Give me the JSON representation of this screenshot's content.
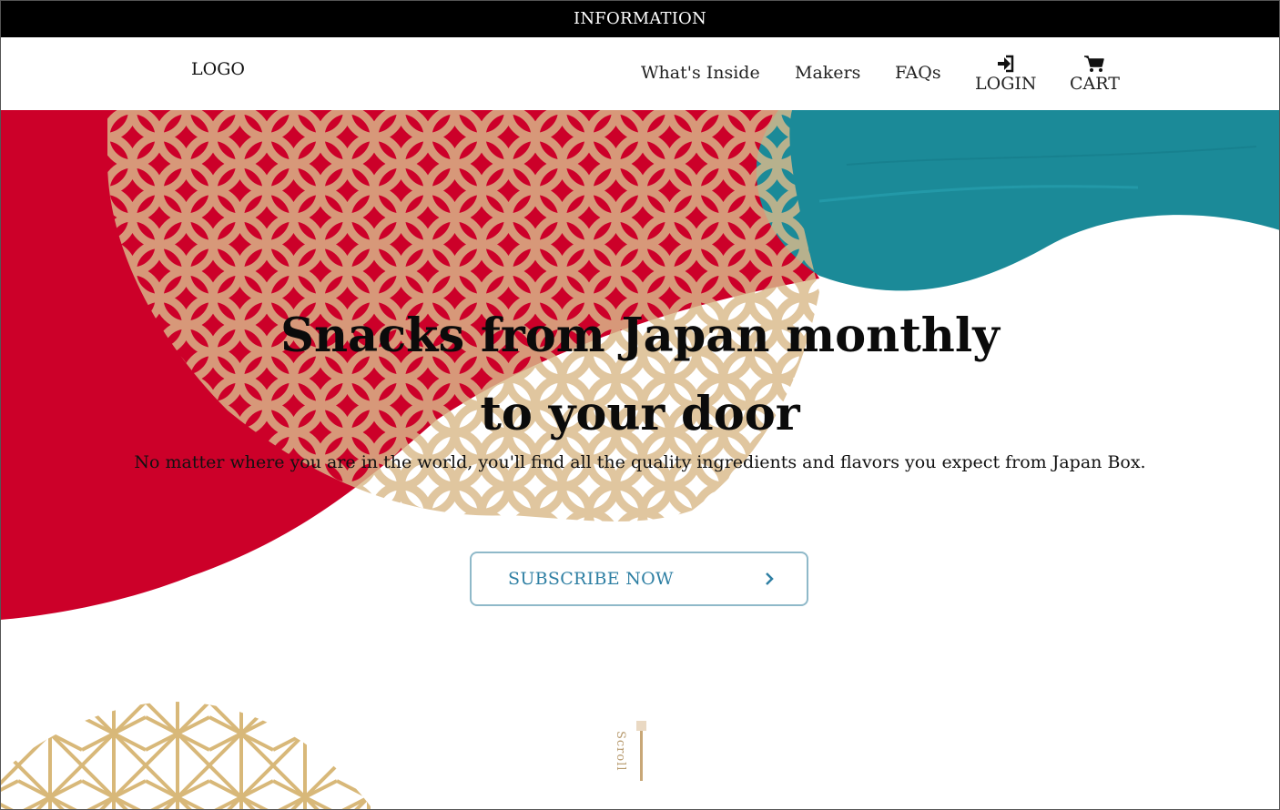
{
  "info_bar": {
    "text": "INFORMATION"
  },
  "nav": {
    "logo": "LOGO",
    "links": [
      "What's Inside",
      "Makers",
      "FAQs"
    ],
    "login": {
      "label": "LOGIN",
      "icon": "sign-in-icon"
    },
    "cart": {
      "label": "CART",
      "icon": "shopping-cart-icon"
    }
  },
  "hero": {
    "headline_line1": "Snacks from Japan monthly",
    "headline_line2": "to your door",
    "subtext": "No matter where you are in the world, you'll find all the quality ingredients and flavors you expect from Japan Box.",
    "cta_label": "SUBSCRIBE NOW",
    "cta_icon": "chevron-right-icon",
    "scroll_label": "Scroll"
  },
  "colors": {
    "red": "#cc0029",
    "teal": "#1b8a98",
    "gold": "#d9b98a",
    "cta_border": "#8fb9c9",
    "cta_text": "#2e7fa3"
  }
}
